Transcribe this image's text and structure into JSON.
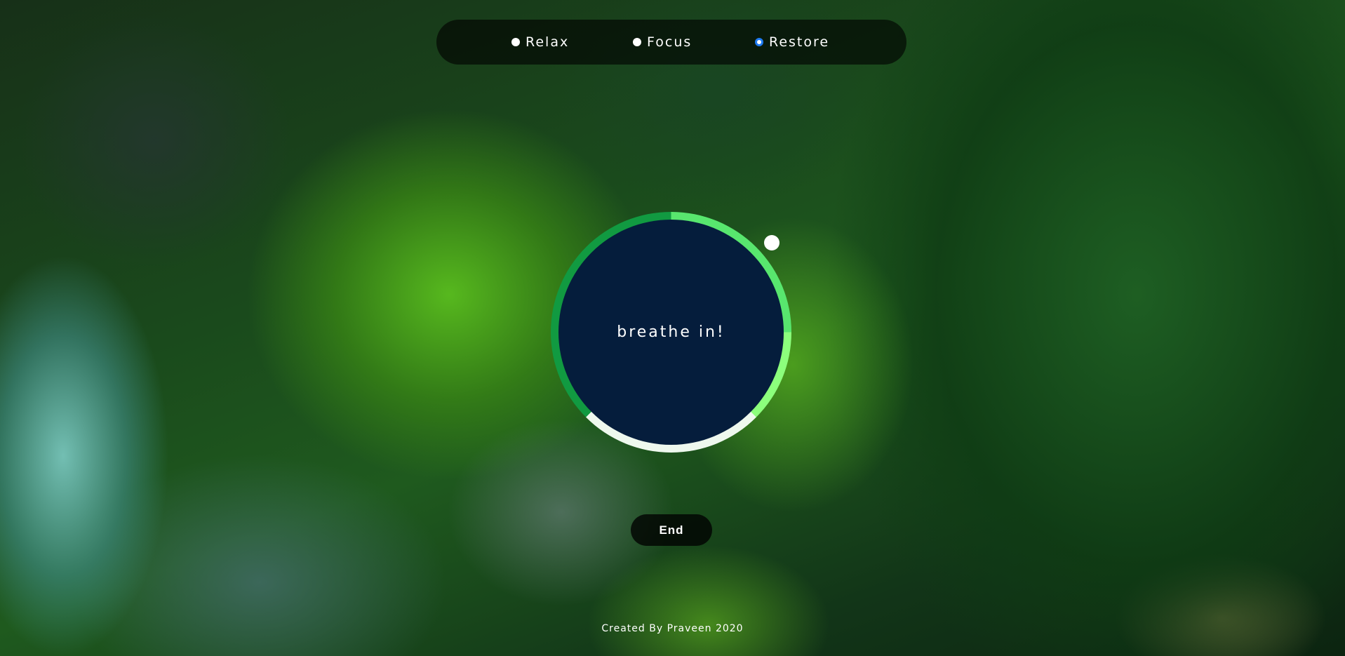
{
  "modes": {
    "options": [
      {
        "label": "Relax",
        "checked": false
      },
      {
        "label": "Focus",
        "checked": false
      },
      {
        "label": "Restore",
        "checked": true
      }
    ]
  },
  "breath": {
    "instruction": "breathe in!"
  },
  "controls": {
    "end_label": "End"
  },
  "footer": {
    "credit": "Created By Praveen 2020"
  },
  "colors": {
    "core": "#051d3c",
    "ring_dark_green": "#119a41",
    "ring_light_green": "#58e66e",
    "ring_pale": "#eef8ee",
    "selected_radio": "#1e7bf2"
  }
}
